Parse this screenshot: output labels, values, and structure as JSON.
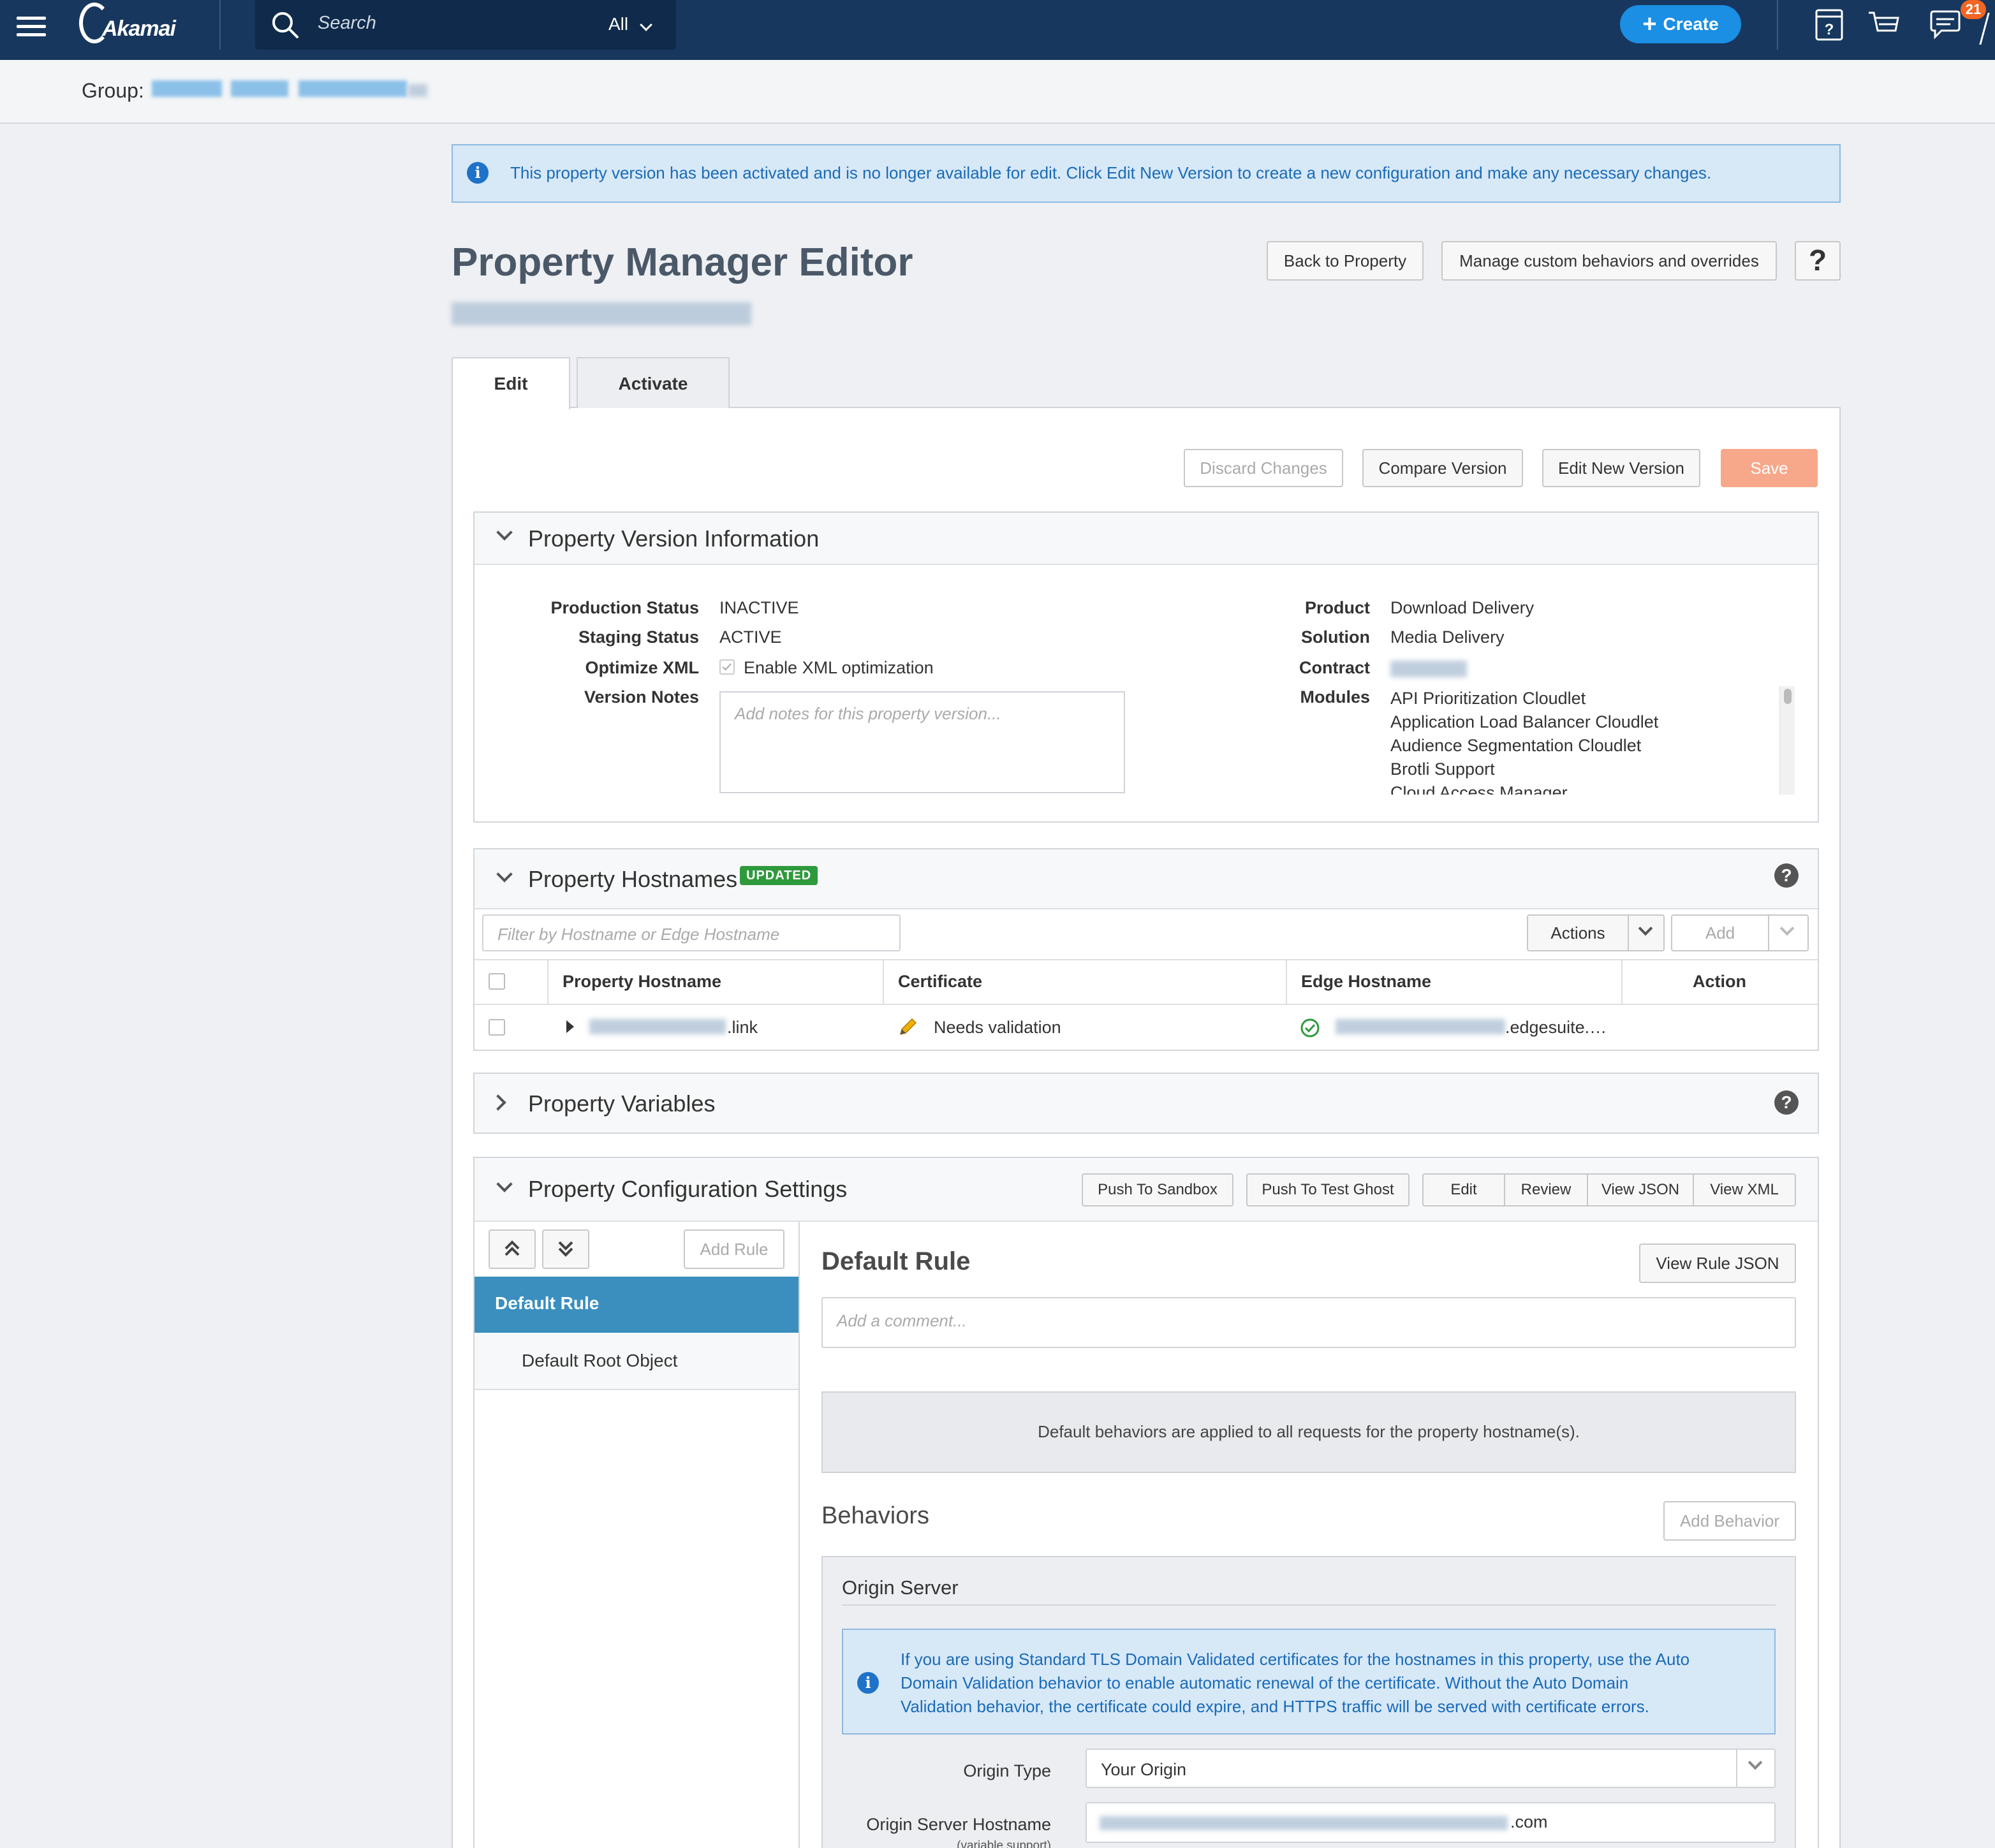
{
  "nav": {
    "logo_text": "Akamai",
    "search_placeholder": "Search",
    "search_scope": "All",
    "create_label": "Create",
    "notification_count": "21"
  },
  "group": {
    "label": "Group:"
  },
  "banner": {
    "text": "This property version has been activated and is no longer available for edit. Click Edit New Version to create a new configuration and make any necessary changes."
  },
  "header": {
    "title": "Property Manager Editor",
    "back_button": "Back to Property",
    "manage_button": "Manage custom behaviors and overrides",
    "help_label": "?"
  },
  "tabs": {
    "edit": "Edit",
    "activate": "Activate"
  },
  "toolbar": {
    "discard": "Discard Changes",
    "compare": "Compare Version",
    "edit_new": "Edit New Version",
    "save": "Save"
  },
  "version_info": {
    "title": "Property Version Information",
    "production_status_label": "Production Status",
    "production_status": "INACTIVE",
    "staging_status_label": "Staging Status",
    "staging_status": "ACTIVE",
    "optimize_xml_label": "Optimize XML",
    "optimize_xml_value": "Enable XML optimization",
    "version_notes_label": "Version Notes",
    "version_notes_placeholder": "Add notes for this property version...",
    "product_label": "Product",
    "product": "Download Delivery",
    "solution_label": "Solution",
    "solution": "Media Delivery",
    "contract_label": "Contract",
    "modules_label": "Modules",
    "modules": [
      "API Prioritization Cloudlet",
      "Application Load Balancer Cloudlet",
      "Audience Segmentation Cloudlet",
      "Brotli Support",
      "Cloud Access Manager"
    ]
  },
  "hostnames": {
    "title": "Property Hostnames",
    "badge": "UPDATED",
    "filter_placeholder": "Filter by Hostname or Edge Hostname",
    "actions_label": "Actions",
    "add_label": "Add",
    "columns": [
      "Property Hostname",
      "Certificate",
      "Edge Hostname",
      "Action"
    ],
    "rows": [
      {
        "hostname_suffix": ".link",
        "certificate": "Needs validation",
        "edge_suffix": ".edgesuite.…"
      }
    ]
  },
  "variables": {
    "title": "Property Variables"
  },
  "config": {
    "title": "Property Configuration Settings",
    "push_sandbox": "Push To Sandbox",
    "push_test_ghost": "Push To Test Ghost",
    "view_modes": [
      "Edit",
      "Review",
      "View JSON",
      "View XML"
    ],
    "add_rule": "Add Rule",
    "rules": [
      "Default Rule",
      "Default Root Object"
    ],
    "rule_title": "Default Rule",
    "view_rule_json": "View Rule JSON",
    "comment_placeholder": "Add a comment...",
    "default_note": "Default behaviors are applied to all requests for the property hostname(s).",
    "behaviors_title": "Behaviors",
    "add_behavior": "Add Behavior",
    "origin_server": {
      "title": "Origin Server",
      "info_lines": [
        "If you are using Standard TLS Domain Validated certificates for the hostnames in this property, use the Auto",
        "Domain Validation behavior to enable automatic renewal of the certificate. Without the Auto Domain",
        "Validation behavior, the certificate could expire, and HTTPS traffic will be served with certificate errors."
      ],
      "origin_type_label": "Origin Type",
      "origin_type_value": "Your Origin",
      "hostname_label": "Origin Server Hostname",
      "hostname_sublabel": "(variable support)",
      "hostname_suffix": ".com"
    }
  },
  "colors": {
    "nav_bg": "#17375e",
    "accent_blue": "#1a8fe3",
    "rule_selected": "#3a8fbf",
    "save_disabled": "#f7a88a",
    "badge_green": "#2e9a3c"
  }
}
